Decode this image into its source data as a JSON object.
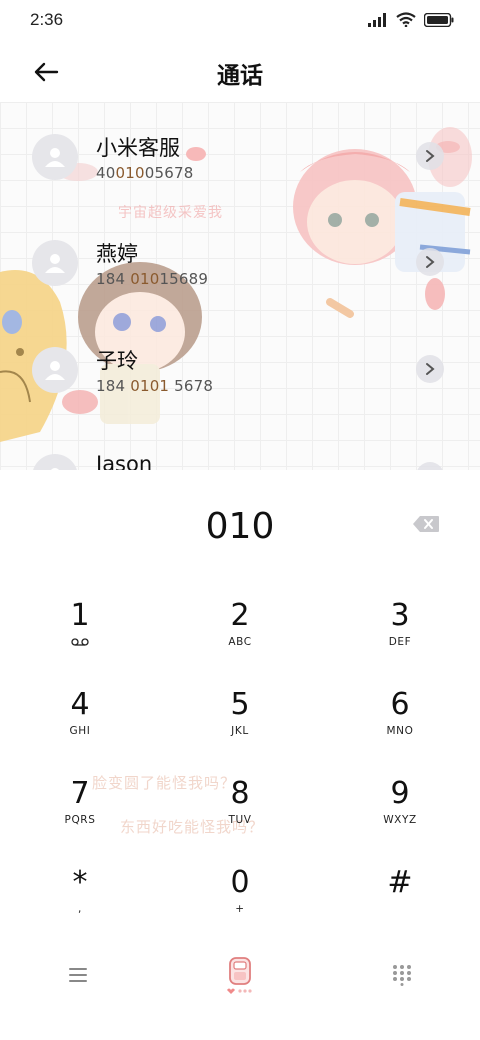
{
  "status_bar": {
    "time": "2:36",
    "icons": [
      "signal-icon",
      "wifi-icon",
      "battery-icon"
    ]
  },
  "header": {
    "title": "通话",
    "back_icon": "back-arrow-icon"
  },
  "contacts": [
    {
      "name": "小米客服",
      "number_prefix": "40",
      "number_match": "010",
      "number_suffix": "05678"
    },
    {
      "name": "燕婷",
      "number_prefix": "184 ",
      "number_match": "010",
      "number_suffix": "15689"
    },
    {
      "name": "子玲",
      "number_prefix": "184 ",
      "number_match": "0101",
      "number_suffix": " 5678"
    },
    {
      "name": "Jason",
      "number_prefix": "",
      "number_match": "",
      "number_suffix": ""
    }
  ],
  "dialer": {
    "input": "010",
    "backspace_icon": "backspace-icon"
  },
  "keypad": [
    {
      "digit": "1",
      "letters": "",
      "sub_icon": "voicemail-icon"
    },
    {
      "digit": "2",
      "letters": "ABC"
    },
    {
      "digit": "3",
      "letters": "DEF"
    },
    {
      "digit": "4",
      "letters": "GHI"
    },
    {
      "digit": "5",
      "letters": "JKL"
    },
    {
      "digit": "6",
      "letters": "MNO"
    },
    {
      "digit": "7",
      "letters": "PQRS"
    },
    {
      "digit": "8",
      "letters": "TUV"
    },
    {
      "digit": "9",
      "letters": "WXYZ"
    },
    {
      "digit": "*",
      "letters": ","
    },
    {
      "digit": "0",
      "letters": "+"
    },
    {
      "digit": "#",
      "letters": ""
    }
  ],
  "background_texts": [
    "宇宙超级采爱我",
    "脸变圆了能怪我吗？",
    "东西好吃能怪我吗？"
  ],
  "bottom_bar": {
    "icons": [
      "menu-icon",
      "dial-call-icon",
      "keypad-grid-icon"
    ]
  },
  "colors": {
    "highlight": "#8a5a2e",
    "accent_pink": "#f08a8a",
    "avatar_bg": "#e6e6ea"
  }
}
